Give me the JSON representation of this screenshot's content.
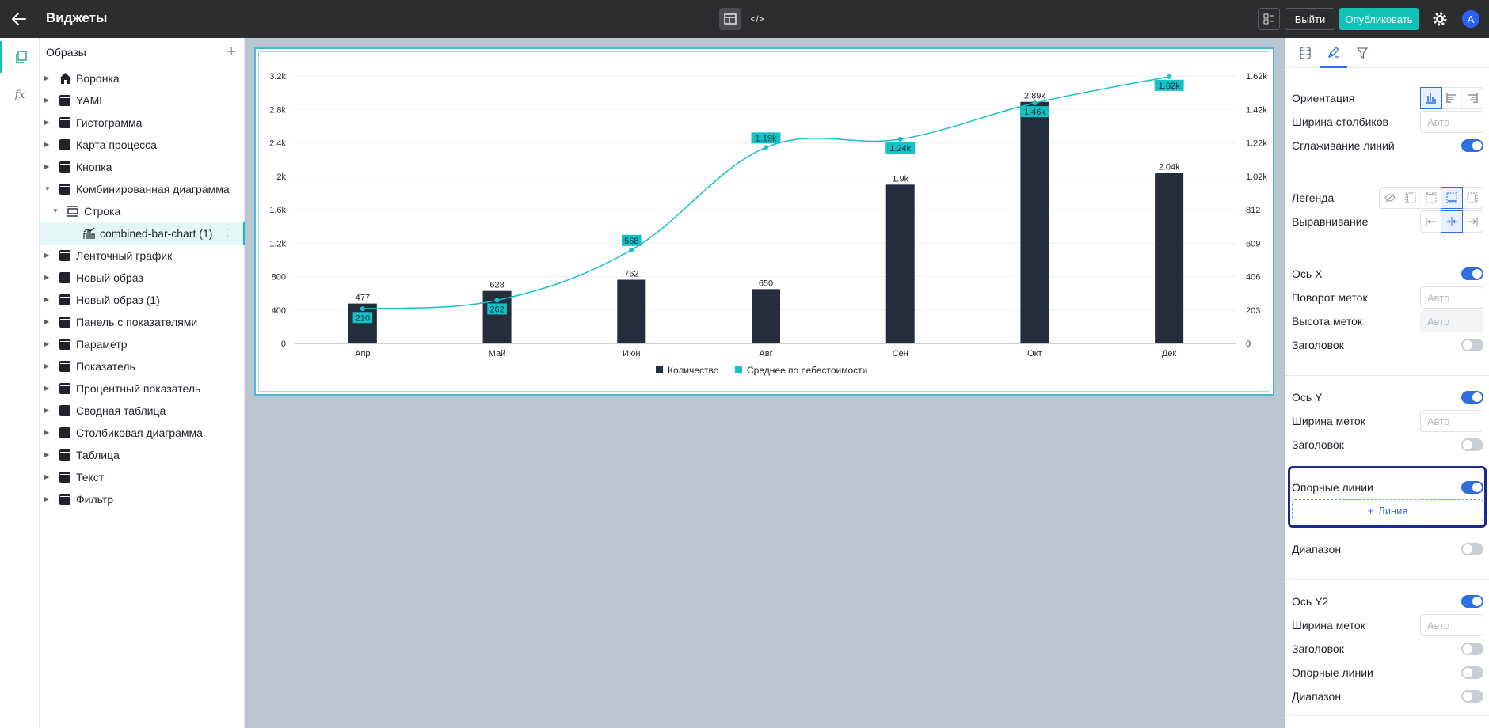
{
  "topbar": {
    "title": "Виджеты",
    "exit_label": "Выйти",
    "publish_label": "Опубликовать",
    "avatar_letter": "A",
    "accent": "#12c2b6"
  },
  "tree": {
    "header": "Образы",
    "items": [
      {
        "label": "Воронка",
        "icon": "home-icon"
      },
      {
        "label": "YAML",
        "icon": "table-icon"
      },
      {
        "label": "Гистограмма",
        "icon": "table-icon"
      },
      {
        "label": "Карта процесса",
        "icon": "table-icon"
      },
      {
        "label": "Кнопка",
        "icon": "table-icon"
      },
      {
        "label": "Комбинированная диаграмма",
        "icon": "table-icon"
      },
      {
        "label": "Строка",
        "icon": "row-icon"
      },
      {
        "label": "combined-bar-chart (1)",
        "icon": "combined-chart-icon"
      },
      {
        "label": "Ленточный график",
        "icon": "table-icon"
      },
      {
        "label": "Новый образ",
        "icon": "table-icon"
      },
      {
        "label": "Новый образ (1)",
        "icon": "table-icon"
      },
      {
        "label": "Панель с показателями",
        "icon": "table-icon"
      },
      {
        "label": "Параметр",
        "icon": "table-icon"
      },
      {
        "label": "Показатель",
        "icon": "table-icon"
      },
      {
        "label": "Процентный показатель",
        "icon": "table-icon"
      },
      {
        "label": "Сводная таблица",
        "icon": "table-icon"
      },
      {
        "label": "Столбиковая диаграмма",
        "icon": "table-icon"
      },
      {
        "label": "Таблица",
        "icon": "table-icon"
      },
      {
        "label": "Текст",
        "icon": "table-icon"
      },
      {
        "label": "Фильтр",
        "icon": "table-icon"
      }
    ]
  },
  "props": {
    "orientation_label": "Ориентация",
    "bar_width_label": "Ширина столбиков",
    "bar_width_placeholder": "Авто",
    "smoothing_label": "Сглаживание линий",
    "legend_label": "Легенда",
    "alignment_label": "Выравнивание",
    "x_axis_label": "Ось X",
    "label_rotation_label": "Поворот меток",
    "label_rotation_placeholder": "Авто",
    "label_height_label": "Высота меток",
    "label_height_placeholder": "Авто",
    "x_title_label": "Заголовок",
    "y_axis_label": "Ось Y",
    "y_label_width_label": "Ширина меток",
    "y_label_width_placeholder": "Авто",
    "y_title_label": "Заголовок",
    "y_ref_lines_label": "Опорные линии",
    "add_line_label": "Линия",
    "y_range_label": "Диапазон",
    "y2_axis_label": "Ось Y2",
    "y2_label_width_label": "Ширина меток",
    "y2_label_width_placeholder": "Авто",
    "y2_title_label": "Заголовок",
    "y2_ref_lines_label": "Опорные линии",
    "y2_range_label": "Диапазон",
    "toggle_on_color": "#2f6fdd"
  },
  "chart_data": {
    "type": "bar",
    "categories": [
      "Апр",
      "Май",
      "Июн",
      "Авг",
      "Сен",
      "Окт",
      "Дек"
    ],
    "series": [
      {
        "name": "Количество",
        "type": "bar",
        "axis": "y",
        "color": "#232d3b",
        "values": [
          477,
          628,
          762,
          650,
          1900,
          2890,
          2040
        ],
        "labels": [
          "477",
          "628",
          "762",
          "650",
          "1.9k",
          "2.89k",
          "2.04k"
        ]
      },
      {
        "name": "Среднее по себестоимости",
        "type": "line",
        "axis": "y2",
        "color": "#12c2c6",
        "values": [
          210,
          262,
          568,
          1190,
          1240,
          1460,
          1620
        ],
        "labels": [
          "210",
          "262",
          "568",
          "1.19k",
          "1.24k",
          "1.46k",
          "1.62k"
        ]
      }
    ],
    "y_ticks": [
      "0",
      "400",
      "800",
      "1.2k",
      "1.6k",
      "2k",
      "2.4k",
      "2.8k",
      "3.2k"
    ],
    "y2_ticks": [
      "0",
      "203",
      "406",
      "609",
      "812",
      "1.02k",
      "1.22k",
      "1.42k",
      "1.62k"
    ],
    "ylim": [
      0,
      3200
    ],
    "y2lim": [
      0,
      1624
    ],
    "legend_position": "bottom-center",
    "grid": true,
    "smooth": true
  }
}
